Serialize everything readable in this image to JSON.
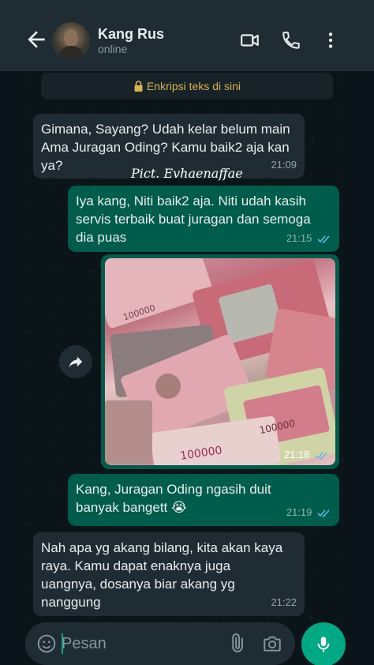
{
  "header": {
    "contact_name": "Kang Rus",
    "status": "online"
  },
  "notice": {
    "text": "Enkripsi teks di sini"
  },
  "watermark": "Pict. Evhaenaffae",
  "messages": [
    {
      "direction": "in",
      "text": "Gimana, Sayang? Udah kelar belum main Ama Juragan Oding? Kamu baik2 aja kan ya?",
      "time": "21:09"
    },
    {
      "direction": "out",
      "text": "Iya kang, Niti baik2 aja. Niti udah kasih servis terbaik buat juragan dan semoga dia puas",
      "time": "21:15",
      "read": true
    },
    {
      "direction": "out",
      "type": "image",
      "caption_time": "21:18",
      "read": true,
      "image_desc": "banknotes"
    },
    {
      "direction": "out",
      "text": "Kang, Juragan Oding ngasih duit banyak bangett 😭",
      "time": "21:19",
      "read": true
    },
    {
      "direction": "in",
      "text": "Nah apa yg akang bilang, kita akan kaya raya. Kamu dapat enaknya juga uangnya, dosanya biar akang yg nanggung",
      "time": "21:22"
    }
  ],
  "input": {
    "placeholder": "Pesan"
  },
  "icons": {
    "back": "arrow-left-icon",
    "video": "video-call-icon",
    "call": "phone-icon",
    "menu": "more-vert-icon",
    "lock": "lock-icon",
    "emoji": "emoji-icon",
    "attach": "paperclip-icon",
    "camera": "camera-icon",
    "mic": "microphone-icon",
    "forward": "forward-icon",
    "ticks": "double-check-icon"
  },
  "colors": {
    "accent": "#00a884",
    "outgoing": "#005c4b",
    "incoming": "#202c33",
    "read_ticks": "#53bdeb"
  }
}
